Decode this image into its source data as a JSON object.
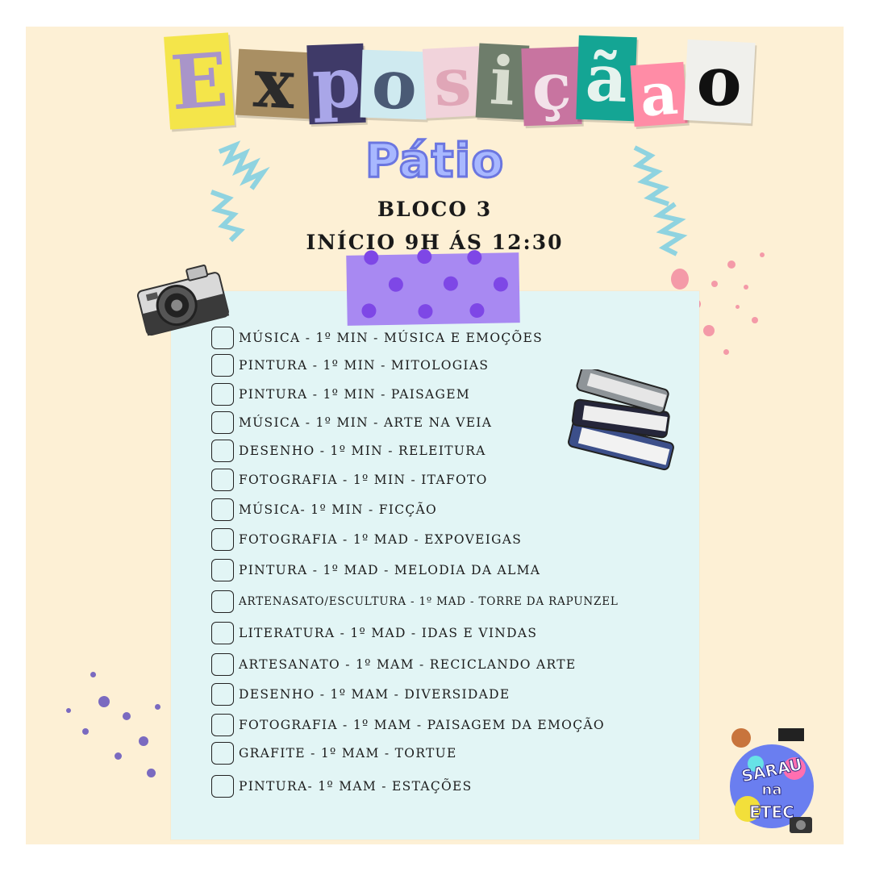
{
  "title": {
    "letters": [
      {
        "char": "E",
        "bg": "#f4e54a",
        "fg": "#a995c9"
      },
      {
        "char": "x",
        "bg": "#a98f63",
        "fg": "#2b2b2b"
      },
      {
        "char": "p",
        "bg": "#3f3a68",
        "fg": "#a9a6e8"
      },
      {
        "char": "o",
        "bg": "#cfeaf0",
        "fg": "#4a5a75"
      },
      {
        "char": "s",
        "bg": "#f1d3db",
        "fg": "#e0a6b7"
      },
      {
        "char": "i",
        "bg": "#6e7d6b",
        "fg": "#d8ddd0"
      },
      {
        "char": "ç",
        "bg": "#c874a0",
        "fg": "#f3e2ea"
      },
      {
        "char": "ã",
        "bg": "#14a594",
        "fg": "#e6f3ee"
      },
      {
        "char": "a",
        "bg": "#ff8ca6",
        "fg": "#ffffff"
      },
      {
        "char": "o",
        "bg": "#f0f0ec",
        "fg": "#111111"
      }
    ]
  },
  "subtitle": "Pátio",
  "block": "BLOCO 3",
  "time": "INÍCIO 9H ÁS 12:30",
  "items": [
    "MÚSICA - 1º MIN - MÚSICA E EMOÇÕES",
    "PINTURA - 1º MIN - MITOLOGIAS",
    "PINTURA - 1º MIN - PAISAGEM",
    "MÚSICA - 1º MIN - ARTE NA VEIA",
    "DESENHO - 1º MIN - RELEITURA",
    "FOTOGRAFIA - 1º MIN - ITAFOTO",
    "MÚSICA- 1º MIN - FICÇÃO",
    "FOTOGRAFIA - 1º MAD - EXPOVEIGAS",
    "PINTURA - 1º MAD - MELODIA DA ALMA",
    "ARTENASATO/ESCULTURA - 1º MAD - TORRE DA RAPUNZEL",
    "LITERATURA - 1º MAD - IDAS E VINDAS",
    "ARTESANATO - 1º MAM - RECICLANDO ARTE",
    "DESENHO - 1º MAM - DIVERSIDADE",
    "FOTOGRAFIA - 1º MAM - PAISAGEM DA EMOÇÃO",
    "GRAFITE - 1º MAM - TORTUE",
    "PINTURA- 1º MAM - ESTAÇÕES"
  ],
  "logo": {
    "line1": "SARAU",
    "line2": "na",
    "line3": "ETEC"
  },
  "colors": {
    "background": "#fdf0d5",
    "paper": "#e2f5f5",
    "tape": "#a889f2",
    "tape_dots": "#7e47e6",
    "zigzag": "#8fd3e0",
    "splatter_pink": "#f49aa8",
    "splatter_purple": "#7a6ac0"
  }
}
